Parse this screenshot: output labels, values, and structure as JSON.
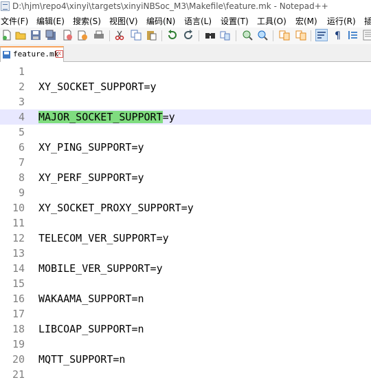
{
  "window": {
    "title": "D:\\hjm\\repo4\\xinyi\\targets\\xinyiNBSoc_M3\\Makefile\\feature.mk - Notepad++"
  },
  "menu": [
    {
      "label": "文件(F)"
    },
    {
      "label": "编辑(E)"
    },
    {
      "label": "搜索(S)"
    },
    {
      "label": "视图(V)"
    },
    {
      "label": "编码(N)"
    },
    {
      "label": "语言(L)"
    },
    {
      "label": "设置(T)"
    },
    {
      "label": "工具(O)"
    },
    {
      "label": "宏(M)"
    },
    {
      "label": "运行(R)"
    },
    {
      "label": "插"
    }
  ],
  "toolbar_icons": [
    "new-file-icon",
    "open-file-icon",
    "save-icon",
    "save-all-icon",
    "close-icon",
    "close-all-icon",
    "print-icon",
    "cut-icon",
    "copy-icon",
    "paste-icon",
    "undo-icon",
    "redo-icon",
    "find-icon",
    "replace-icon",
    "zoom-in-icon",
    "zoom-out-icon",
    "sync-vertical-icon",
    "sync-horizontal-icon",
    "word-wrap-icon",
    "show-all-chars-icon",
    "indent-guide-icon",
    "doc-map-icon"
  ],
  "tabs": [
    {
      "label": "feature.mk",
      "close": "x"
    }
  ],
  "editor": {
    "current_line": 4,
    "highlight_word": "MAJOR_SOCKET_SUPPORT",
    "lines": [
      {
        "num": "1",
        "text": ""
      },
      {
        "num": "2",
        "text": "XY_SOCKET_SUPPORT=y"
      },
      {
        "num": "3",
        "text": ""
      },
      {
        "num": "4",
        "text": "=y",
        "prefix": "MAJOR_SOCKET_SUPPORT"
      },
      {
        "num": "5",
        "text": ""
      },
      {
        "num": "6",
        "text": "XY_PING_SUPPORT=y"
      },
      {
        "num": "7",
        "text": ""
      },
      {
        "num": "8",
        "text": "XY_PERF_SUPPORT=y"
      },
      {
        "num": "9",
        "text": ""
      },
      {
        "num": "10",
        "text": "XY_SOCKET_PROXY_SUPPORT=y"
      },
      {
        "num": "11",
        "text": ""
      },
      {
        "num": "12",
        "text": "TELECOM_VER_SUPPORT=y"
      },
      {
        "num": "13",
        "text": ""
      },
      {
        "num": "14",
        "text": "MOBILE_VER_SUPPORT=y"
      },
      {
        "num": "15",
        "text": ""
      },
      {
        "num": "16",
        "text": "WAKAAMA_SUPPORT=n"
      },
      {
        "num": "17",
        "text": ""
      },
      {
        "num": "18",
        "text": "LIBCOAP_SUPPORT=n"
      },
      {
        "num": "19",
        "text": ""
      },
      {
        "num": "20",
        "text": "MQTT_SUPPORT=n"
      },
      {
        "num": "21",
        "text": ""
      }
    ]
  }
}
